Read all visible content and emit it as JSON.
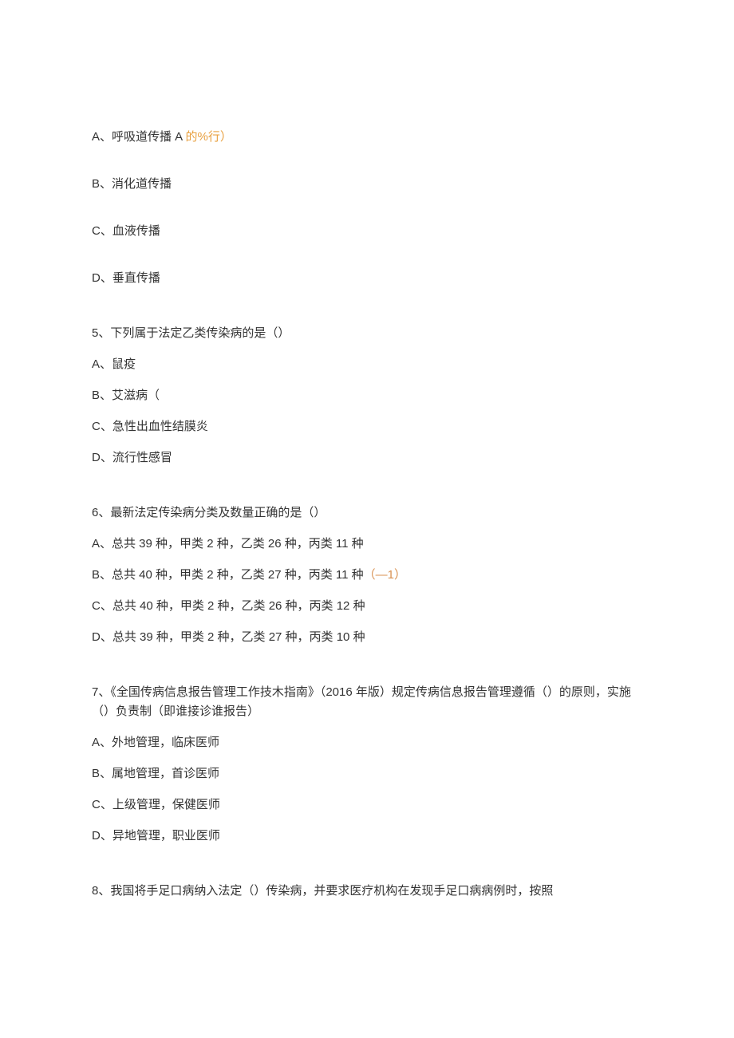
{
  "options_block1": {
    "a": "A、呼吸道传播 A",
    "a_highlight": " 的%行）",
    "b": "B、消化道传播",
    "c": "C、血液传播",
    "d": "D、垂直传播"
  },
  "q5": {
    "stem": "5、下列属于法定乙类传染病的是（）",
    "a": "A、鼠疫",
    "b": "B、艾滋病（",
    "c": "C、急性出血性结膜炎",
    "d": "D、流行性感冒"
  },
  "q6": {
    "stem": "6、最新法定传染病分类及数量正确的是（）",
    "a": "A、总共 39 种，甲类 2 种，乙类 26 种，丙类 11 种",
    "b": "B、总共 40 种，甲类 2 种，乙类 27 种，丙类 11 种",
    "b_highlight": "（—1）",
    "c": "C、总共 40 种，甲类 2 种，乙类 26 种，丙类 12 种",
    "d": "D、总共 39 种，甲类 2 种，乙类 27 种，丙类 10 种"
  },
  "q7": {
    "stem": "7、《全国传病信息报告管理工作技木指南》（2016 年版）规定传病信息报告管理遵循（）的原则，实施（）负责制（即谁接诊谁报告）",
    "a": "A、外地管理，临床医师",
    "b": "B、属地管理，首诊医师",
    "c": "C、上级管理，保健医师",
    "d": "D、异地管理，职业医师"
  },
  "q8": {
    "stem": "8、我国将手足口病纳入法定（）传染病，并要求医疗机构在发现手足口病病例时，按照"
  }
}
